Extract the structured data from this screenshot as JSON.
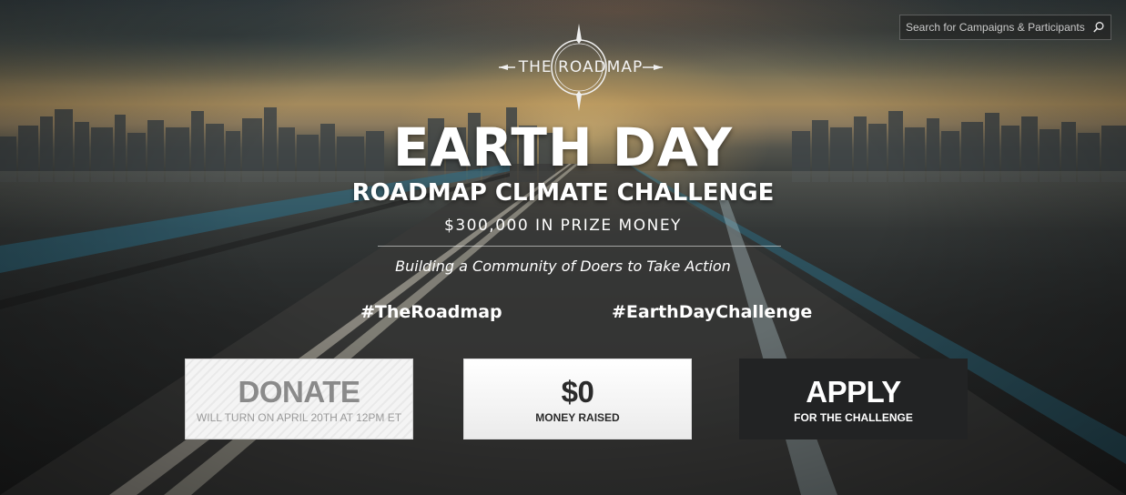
{
  "search": {
    "placeholder": "Search for Campaigns & Participants",
    "icon": "search-icon"
  },
  "logo": {
    "text": "THE ROADMAP",
    "icon": "compass-icon"
  },
  "hero": {
    "title": "EARTH DAY",
    "subtitle": "ROADMAP CLIMATE CHALLENGE",
    "prize": "$300,000 IN PRIZE MONEY",
    "tagline": "Building a Community of Doers to Take Action"
  },
  "hashtags": [
    "#TheRoadmap",
    "#EarthDayChallenge"
  ],
  "cards": {
    "donate": {
      "title": "DONATE",
      "subtitle": "WILL TURN ON APRIL 20TH AT 12PM ET"
    },
    "raised": {
      "title": "$0",
      "subtitle": "MONEY RAISED"
    },
    "apply": {
      "title": "APPLY",
      "subtitle": "FOR THE CHALLENGE"
    }
  },
  "colors": {
    "accent_dark": "#222324",
    "text": "#ffffff",
    "disabled": "#8a8a8a"
  }
}
